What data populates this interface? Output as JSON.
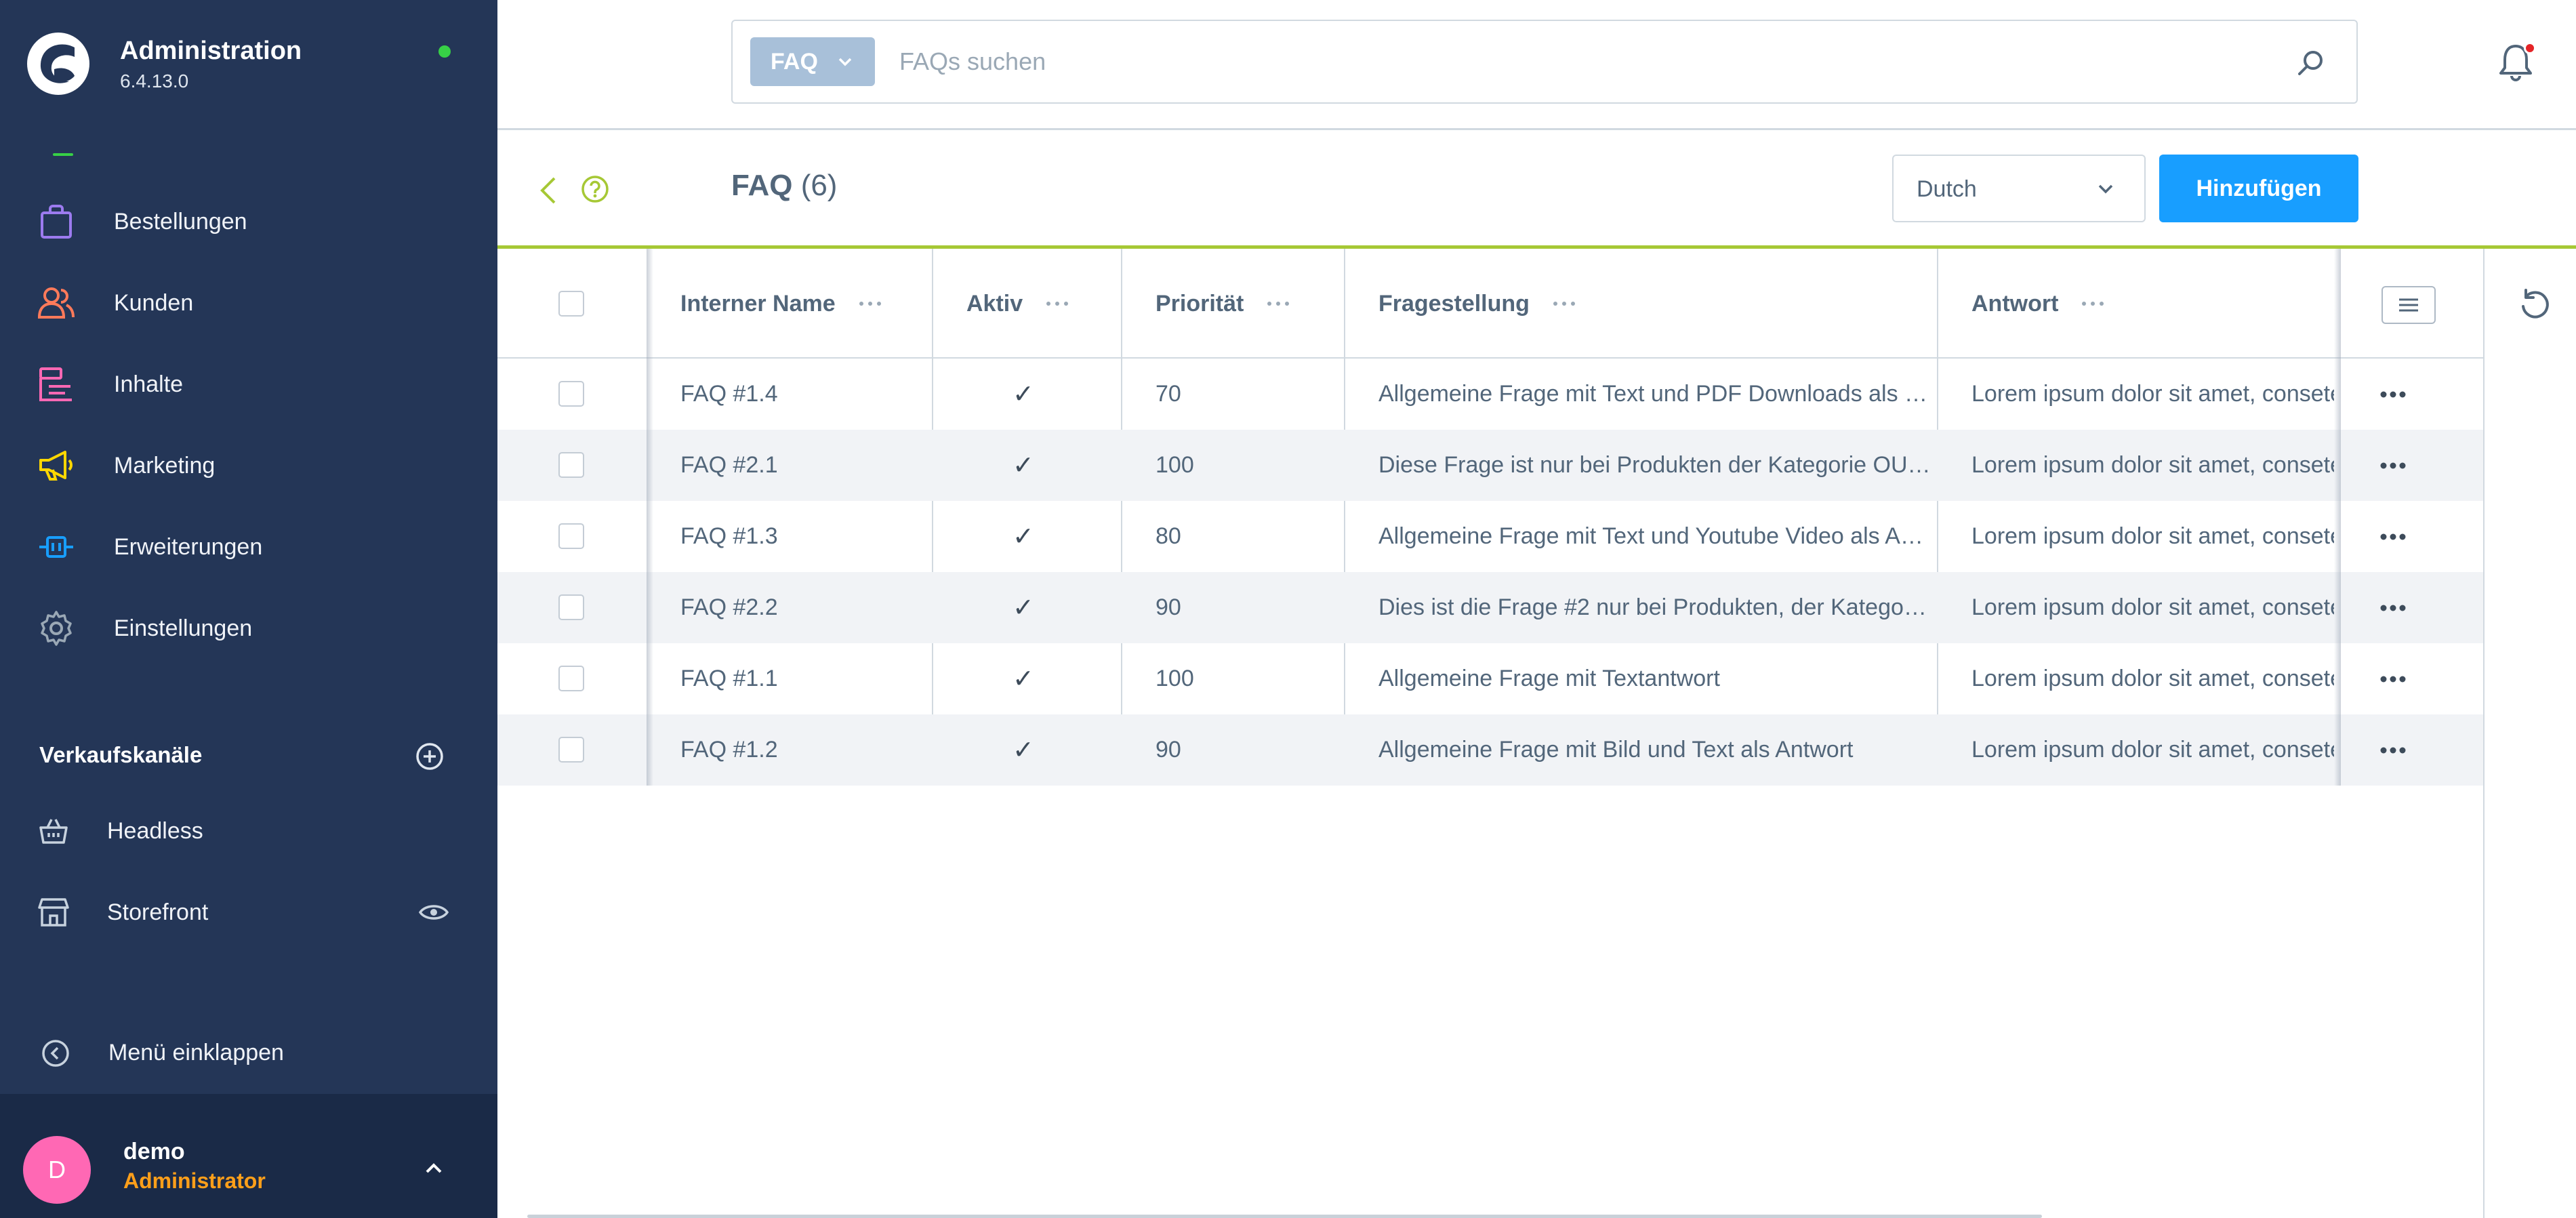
{
  "app": {
    "title": "Administration",
    "version": "6.4.13.0"
  },
  "sidebar": {
    "nav": [
      {
        "label": "Bestellungen",
        "icon": "shopping-bag-icon",
        "color": "#9c7bef"
      },
      {
        "label": "Kunden",
        "icon": "users-icon",
        "color": "#ff7a5a"
      },
      {
        "label": "Inhalte",
        "icon": "content-icon",
        "color": "#ff68b4"
      },
      {
        "label": "Marketing",
        "icon": "megaphone-icon",
        "color": "#ffd700"
      },
      {
        "label": "Erweiterungen",
        "icon": "plug-icon",
        "color": "#189eff"
      },
      {
        "label": "Einstellungen",
        "icon": "gear-icon",
        "color": "#9aa8b5"
      }
    ],
    "section_title": "Verkaufskanäle",
    "channels": [
      {
        "label": "Headless",
        "icon": "basket-icon"
      },
      {
        "label": "Storefront",
        "icon": "storefront-icon"
      }
    ],
    "collapse_label": "Menü einklappen",
    "user": {
      "initial": "D",
      "name": "demo",
      "role": "Administrator"
    }
  },
  "search": {
    "type_label": "FAQ",
    "placeholder": "FAQs suchen"
  },
  "smartbar": {
    "title": "FAQ",
    "count": "(6)",
    "language": "Dutch",
    "add_label": "Hinzufügen"
  },
  "table": {
    "columns": [
      "Interner Name",
      "Aktiv",
      "Priorität",
      "Fragestellung",
      "Antwort"
    ],
    "rows": [
      {
        "name": "FAQ #1.4",
        "active": "✓",
        "priority": "70",
        "question": "Allgemeine Frage mit Text und PDF Downloads als …",
        "answer": "Lorem ipsum dolor sit amet, consetetur"
      },
      {
        "name": "FAQ #2.1",
        "active": "✓",
        "priority": "100",
        "question": "Diese Frage ist nur bei Produkten der Kategorie OU…",
        "answer": "Lorem ipsum dolor sit amet, consetetur"
      },
      {
        "name": "FAQ #1.3",
        "active": "✓",
        "priority": "80",
        "question": "Allgemeine Frage mit Text und Youtube Video als A…",
        "answer": "Lorem ipsum dolor sit amet, consetetur"
      },
      {
        "name": "FAQ #2.2",
        "active": "✓",
        "priority": "90",
        "question": "Dies ist die Frage #2 nur bei Produkten, der Katego…",
        "answer": "Lorem ipsum dolor sit amet, consetetur"
      },
      {
        "name": "FAQ #1.1",
        "active": "✓",
        "priority": "100",
        "question": "Allgemeine Frage mit Textantwort",
        "answer": "Lorem ipsum dolor sit amet, consetetur"
      },
      {
        "name": "FAQ #1.2",
        "active": "✓",
        "priority": "90",
        "question": "Allgemeine Frage mit Bild und Text als Antwort",
        "answer": "Lorem ipsum dolor sit amet, consetetur"
      }
    ]
  },
  "colors": {
    "sidebar_bg": "#243657",
    "accent_blue": "#189eff",
    "accent_green": "#a6c835",
    "status_online": "#37d046",
    "role_color": "#ff9f1a"
  }
}
